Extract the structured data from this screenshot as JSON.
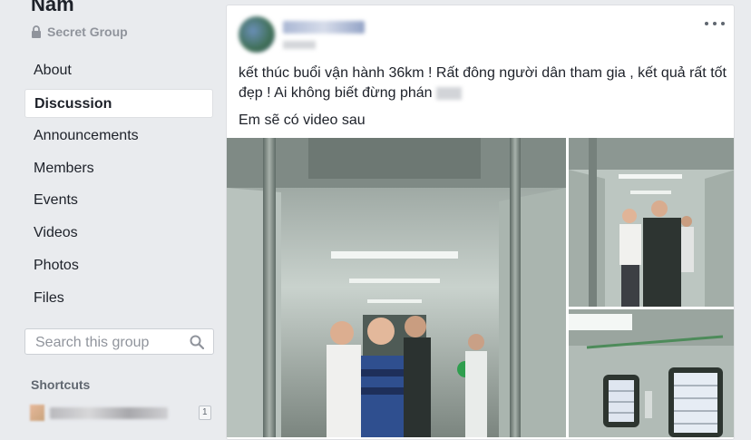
{
  "group": {
    "name": "Nam",
    "privacy": "Secret Group"
  },
  "nav": {
    "items": [
      {
        "label": "About"
      },
      {
        "label": "Discussion",
        "active": true
      },
      {
        "label": "Announcements"
      },
      {
        "label": "Members"
      },
      {
        "label": "Events"
      },
      {
        "label": "Videos"
      },
      {
        "label": "Photos"
      },
      {
        "label": "Files"
      }
    ]
  },
  "search": {
    "placeholder": "Search this group"
  },
  "shortcuts": {
    "title": "Shortcuts",
    "items": [
      {
        "badge": "1"
      }
    ]
  },
  "post": {
    "text_line1": "kết thúc buổi vận hành 36km ! Rất đông người dân tham gia , kết quả rất tốt đẹp ! Ai không biết đừng phán",
    "text_line2": "Em sẽ có video sau",
    "photo_count": 3
  },
  "icons": {
    "lock": "lock-icon",
    "search": "search-icon",
    "more": "more-options-icon"
  },
  "colors": {
    "background": "#e9ebee",
    "card": "#ffffff",
    "muted": "#90949c",
    "text": "#1d2129"
  }
}
